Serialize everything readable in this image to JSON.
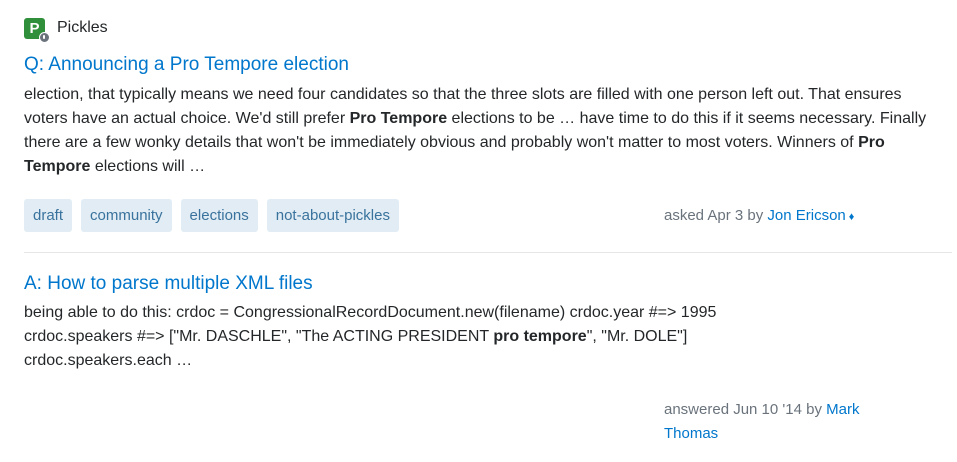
{
  "site": {
    "logo_letter": "P",
    "name": "Pickles"
  },
  "results": [
    {
      "title": "Q: Announcing a Pro Tempore election",
      "excerpt_parts": [
        {
          "text": "election, that typically means we need four candidates so that the three slots are filled with one person left out. That ensures voters have an actual choice. We'd still prefer ",
          "bold": false
        },
        {
          "text": "Pro Tempore",
          "bold": true
        },
        {
          "text": " elections to be … have time to do this if it seems necessary. Finally there are a few wonky details that won't be immediately obvious and probably won't matter to most voters. Winners of ",
          "bold": false
        },
        {
          "text": "Pro Tempore",
          "bold": true
        },
        {
          "text": " elections will …",
          "bold": false
        }
      ],
      "tags": [
        "draft",
        "community",
        "elections",
        "not-about-pickles"
      ],
      "meta": {
        "action": "asked Apr 3 by ",
        "user": "Jon Ericson",
        "moderator_symbol": "♦"
      }
    },
    {
      "title": "A: How to parse multiple XML files",
      "excerpt_parts": [
        {
          "text": "being able to do this: crdoc = CongressionalRecordDocument.new(filename) crdoc.year #=> 1995",
          "bold": false
        },
        {
          "text": "crdoc.speakers #=> [\"Mr. DASCHLE\", \"The ACTING PRESIDENT ",
          "bold": false
        },
        {
          "text": "pro tempore",
          "bold": true
        },
        {
          "text": "\", \"Mr. DOLE\"]",
          "bold": false
        },
        {
          "text": "crdoc.speakers.each …",
          "bold": false
        }
      ],
      "meta": {
        "action": "answered Jun 10 '14 by ",
        "user_line1": "Mark",
        "user_line2": "Thomas"
      }
    }
  ],
  "colors": {
    "link": "#0077cc",
    "tag_bg": "#e1ecf4",
    "tag_text": "#39739d",
    "meta_text": "#6a737c",
    "logo_green": "#2f8f3a"
  },
  "icons": {
    "site_logo": "pickles-site-logo-icon",
    "moderator": "diamond-icon"
  }
}
